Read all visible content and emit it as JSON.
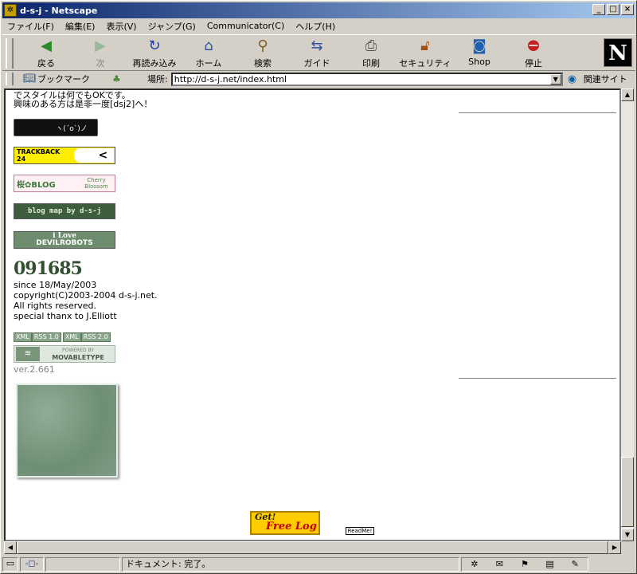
{
  "window": {
    "title": "d-s-j - Netscape",
    "controls": [
      "_",
      "□",
      "×"
    ]
  },
  "menubar": [
    "ファイル(F)",
    "編集(E)",
    "表示(V)",
    "ジャンプ(G)",
    "Communicator(C)",
    "ヘルプ(H)"
  ],
  "toolbar": {
    "buttons": [
      {
        "label": "戻る",
        "icon": "back-arrow-icon",
        "enabled": true
      },
      {
        "label": "次",
        "icon": "forward-arrow-icon",
        "enabled": false
      },
      {
        "label": "再読み込み",
        "icon": "reload-icon",
        "enabled": true
      },
      {
        "label": "ホーム",
        "icon": "home-icon",
        "enabled": true
      },
      {
        "label": "検索",
        "icon": "search-icon",
        "enabled": true
      },
      {
        "label": "ガイド",
        "icon": "guide-icon",
        "enabled": true
      },
      {
        "label": "印刷",
        "icon": "print-icon",
        "enabled": true
      },
      {
        "label": "セキュリティ",
        "icon": "security-lock-icon",
        "enabled": true
      },
      {
        "label": "Shop",
        "icon": "shop-icon",
        "enabled": true
      },
      {
        "label": "停止",
        "icon": "stop-icon",
        "enabled": true
      }
    ],
    "logo": "N"
  },
  "location": {
    "bookmarks_label": "ブックマーク",
    "location_label": "場所:",
    "url": "http://d-s-j.net/index.html",
    "related_label": "関連サイト"
  },
  "page": {
    "intro_line1": "でスタイルは何でもOKです。",
    "intro_line2": "興味のある方は是非一度[dsj2]へ！",
    "banners": {
      "face": "ヽ(´o`)ノ",
      "trackback_top": "TRACKBACK",
      "trackback_num": "24",
      "sakura": "桜✿BLOG",
      "sakura_sub": "Cherry Blossom",
      "blogmap": "blog map by d-s-j",
      "devil_top": "i Love",
      "devil_bottom": "DEVILROBOTS"
    },
    "counter": "091685",
    "footer_lines": [
      "since 18/May/2003",
      "copyright(C)2003-2004 d-s-j.net.",
      "All rights reserved.",
      "special thanx to J.Elliott"
    ],
    "rss": [
      {
        "tag": "XML",
        "label": "RSS 1.0"
      },
      {
        "tag": "XML",
        "label": "RSS 2.0"
      }
    ],
    "powered_top": "POWERED BY",
    "powered_bottom": "MOVABLETYPE",
    "version": "ver.2.661",
    "getlog_top": "Get!",
    "getlog_bottom": "Free Log",
    "readme": "ReadMe!"
  },
  "statusbar": {
    "text": "ドキュメント: 完了。"
  },
  "colors": {
    "title_start": "#0a246a",
    "title_end": "#a6caf0",
    "chrome": "#d4d0c8"
  }
}
